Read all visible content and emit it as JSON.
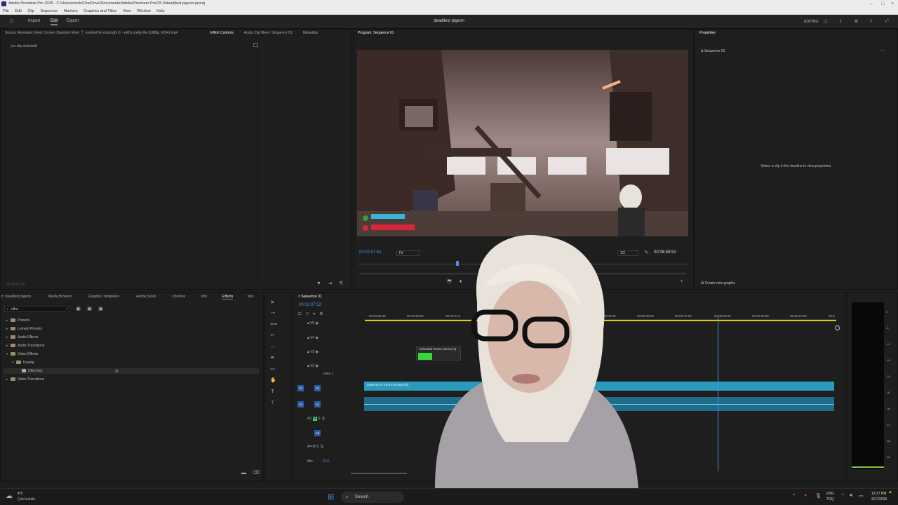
{
  "window": {
    "title": "Adobe Premiere Pro 2025 - C:\\Users\\merle\\OneDrive\\Documents\\Adobe\\Premiere Pro\\25.0\\deadliest pigeon.prproj"
  },
  "menu": [
    "File",
    "Edit",
    "Clip",
    "Sequence",
    "Markers",
    "Graphics and Titles",
    "View",
    "Window",
    "Help"
  ],
  "appbar": {
    "tabs": [
      "Import",
      "Edit",
      "Export"
    ],
    "active_tab": "Edit",
    "project_name": "deadliest pigeon",
    "workspace": "EDITING"
  },
  "source_panel": {
    "source_label": "Source: Animated Green Screen Question Mark ❓ symbol No copyright © - prill's pretty life (1080p, h264).mp4",
    "tabs": [
      "Effect Controls",
      "Audio Clip Mixer: Sequence 01",
      "Metadata"
    ],
    "active_tab": "Effect Controls",
    "no_clip": "(no clip selected)",
    "timecode": "00:02:07:52"
  },
  "program_monitor": {
    "title": "Program: Sequence 01",
    "timecode": "00:02:07:52",
    "fit": "Fit",
    "resolution": "1/2",
    "duration": "00:06:59:52"
  },
  "properties": {
    "title": "Properties",
    "sequence": "Sequence 01",
    "hint": "Select a clip in the timeline to view properties.",
    "create_graphic": "Create new graphic"
  },
  "project_tabs": {
    "tabs": [
      "ct: deadliest pigeon",
      "Media Browser",
      "Graphics Templates",
      "Adobe Stock",
      "Libraries",
      "Info",
      "Effects",
      "Mar"
    ],
    "active_tab": "Effects",
    "search": "ultra"
  },
  "effects_tree": [
    {
      "label": "Presets",
      "level": 0,
      "open": false
    },
    {
      "label": "Lumetri Presets",
      "level": 0,
      "open": false
    },
    {
      "label": "Audio Effects",
      "level": 0,
      "open": false
    },
    {
      "label": "Audio Transitions",
      "level": 0,
      "open": false
    },
    {
      "label": "Video Effects",
      "level": 0,
      "open": true
    },
    {
      "label": "Keying",
      "level": 1,
      "open": true
    },
    {
      "label": "Ultra Key",
      "level": 2,
      "open": false
    },
    {
      "label": "Video Transitions",
      "level": 0,
      "open": false
    }
  ],
  "timeline": {
    "title": "Sequence 01",
    "timecode": "00:02:07:52",
    "ruler": [
      "00:01:59:00",
      "00:02:00:00",
      "00:02:01:0",
      "00:05:00",
      "00:02:06:00",
      "00:02:07:00",
      "00:02:08:00",
      "00:02:09:00",
      "00:02:10:00",
      "00:0"
    ],
    "tracks": [
      {
        "id": "V6"
      },
      {
        "id": "V4"
      },
      {
        "id": "V3"
      },
      {
        "id": "V2",
        "name": "Video 2"
      },
      {
        "id": "V1"
      },
      {
        "id": "A1"
      },
      {
        "id": "A2"
      },
      {
        "id": "A3"
      },
      {
        "id": "A4"
      }
    ],
    "mix_label": "Mix",
    "mix_value": "15.0",
    "clip_green": "Animated Green Screen Q",
    "clip_main": "2026-02-27 15-51-33.mp4 [V]"
  },
  "meters": [
    "0",
    "-6",
    "-12",
    "-18",
    "-24",
    "-30",
    "-36",
    "-42",
    "-48",
    "-54",
    "dB"
  ],
  "taskbar": {
    "weather_temp": "4°C",
    "weather_desc": "Çok bulutlu",
    "search": "Search",
    "lang1": "ENG",
    "lang2": "TRQ",
    "time": "13:27 PM",
    "date": "2/27/2026"
  }
}
